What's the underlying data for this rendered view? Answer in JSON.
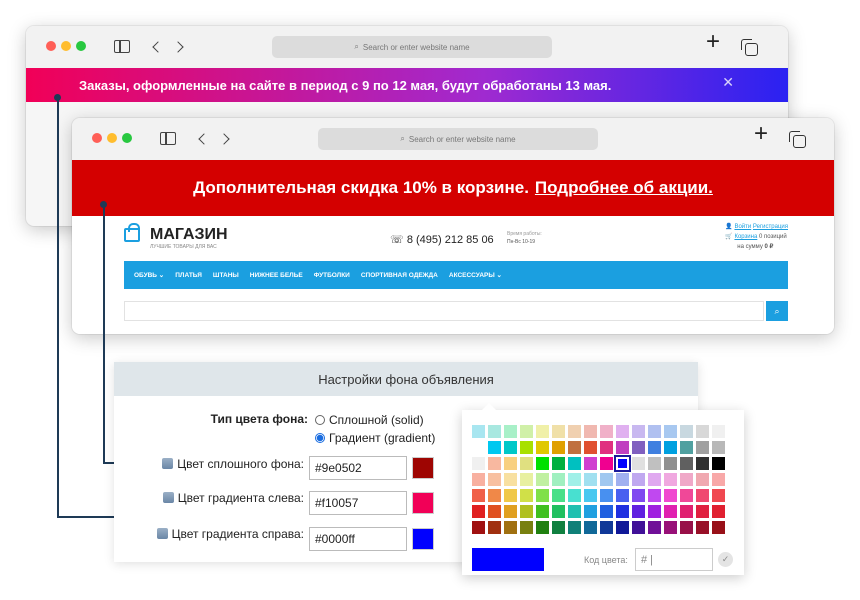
{
  "browser": {
    "search_placeholder": "Search or enter website name",
    "search_icon": "search-icon",
    "new_tab_label": "+"
  },
  "banner_gradient": {
    "text": "Заказы, оформленные на сайте в период с 9 по 12 мая, будут обработаны 13 мая.",
    "close": "✕",
    "colors": [
      "#f10057",
      "#0000ff"
    ]
  },
  "banner_solid": {
    "text": "Дополнительная скидка 10% в корзине.",
    "link": "Подробнее об акции.",
    "color": "#9e0502"
  },
  "shop": {
    "logo": "МАГАЗИН",
    "tagline": "ЛУЧШИЕ ТОВАРЫ ДЛЯ ВАС",
    "phone": "8 (495) 212 85 06",
    "hours_label": "Время работы:",
    "hours_value": "Пн-Вс 10-19",
    "login": "Войти",
    "register": "Регистрация",
    "cart_link": "Корзина",
    "cart_count": "0 позиций",
    "cart_sum_label": "на сумму",
    "cart_sum": "0 ₽",
    "nav": [
      "ОБУВЬ ⌄",
      "ПЛАТЬЯ",
      "ШТАНЫ",
      "НИЖНЕЕ БЕЛЬЕ",
      "ФУТБОЛКИ",
      "СПОРТИВНАЯ ОДЕЖДА",
      "АКСЕССУАРЫ ⌄"
    ],
    "accent": "#1b9fe0"
  },
  "settings": {
    "title": "Настройки фона объявления",
    "type_label": "Тип цвета фона:",
    "option_solid": "Сплошной (solid)",
    "option_gradient": "Градиент (gradient)",
    "selected": "gradient",
    "solid_label": "Цвет сплошного фона:",
    "solid_value": "#9e0502",
    "left_label": "Цвет градиента слева:",
    "left_value": "#f10057",
    "right_label": "Цвет градиента справа:",
    "right_value": "#0000ff"
  },
  "picker": {
    "code_label": "Код цвета:",
    "code_prefix": "#",
    "ok": "✓",
    "preview": "#0000ff",
    "palette": [
      [
        "#a8e6f0",
        "#a8e8e0",
        "#a8f0c8",
        "#d0f0a8",
        "#f0f0a8",
        "#f0e0a8",
        "#f0d0b0",
        "#f0b8b0",
        "#f0b0c8",
        "#e0b0f0",
        "#c8b8f0",
        "#b0c0f0",
        "#a8c8f0",
        "#c8d8e0",
        "#d8d8d8",
        "#f0f0f0"
      ],
      [
        "#ffffff",
        "#00c8f0",
        "#00c8c8",
        "#a8e000",
        "#e0c800",
        "#e0a000",
        "#c07040",
        "#e05030",
        "#e03080",
        "#c040c0",
        "#8060c0",
        "#4080e0",
        "#00a0e0",
        "#50a0a0",
        "#a0a0a0",
        "#b8b8b8"
      ],
      [
        "#f0f0f0",
        "#f8b8a0",
        "#f8d080",
        "#e0e080",
        "#00e000",
        "#00b040",
        "#00c0c0",
        "#d040d0",
        "#f00090",
        "#0000ff",
        "#e0e0e0",
        "#c0c0c0",
        "#909090",
        "#606060",
        "#303030",
        "#000000"
      ],
      [
        "#f8b0a0",
        "#f8c0a0",
        "#f8e0a0",
        "#e8f0a0",
        "#c0f0a0",
        "#a0f0c0",
        "#a0f0e8",
        "#a0e0f0",
        "#a0c8f0",
        "#a0b0f0",
        "#c0a8f0",
        "#e0a8f0",
        "#f0a8e0",
        "#f0a8c8",
        "#f0a8b0",
        "#f8a8a8"
      ],
      [
        "#f06048",
        "#f08848",
        "#f0c848",
        "#d0e048",
        "#80e048",
        "#48e088",
        "#48e0d0",
        "#48c8f0",
        "#4890f0",
        "#4860f0",
        "#8048f0",
        "#c048f0",
        "#f048d0",
        "#f04898",
        "#f04870",
        "#f04850"
      ],
      [
        "#e02020",
        "#e05020",
        "#e0a020",
        "#b0c020",
        "#40c020",
        "#20c060",
        "#20c0b0",
        "#20a0e0",
        "#2060e0",
        "#2030e0",
        "#6020e0",
        "#a020e0",
        "#e020b0",
        "#e02070",
        "#e02040",
        "#e02030"
      ],
      [
        "#a01010",
        "#a03010",
        "#a07010",
        "#788010",
        "#208010",
        "#108040",
        "#108078",
        "#106898",
        "#103898",
        "#101898",
        "#401098",
        "#701098",
        "#981078",
        "#981048",
        "#981028",
        "#981018"
      ]
    ],
    "selected_index": [
      2,
      9
    ]
  }
}
